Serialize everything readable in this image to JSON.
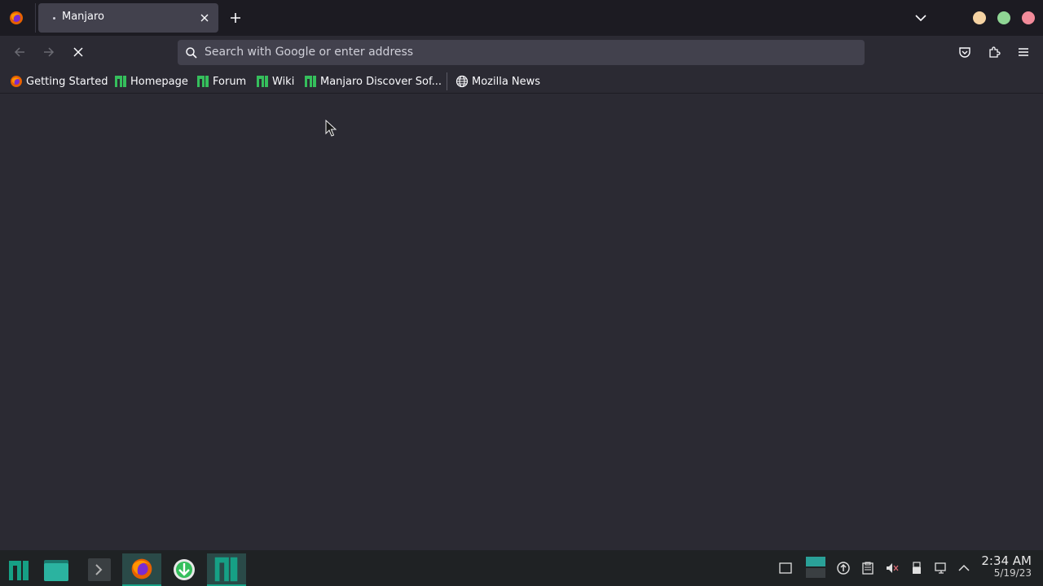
{
  "browser": {
    "tab": {
      "title": "Manjaro"
    },
    "urlbar": {
      "placeholder": "Search with Google or enter address"
    }
  },
  "bookmarks": [
    {
      "label": "Getting Started",
      "icon": "firefox-icon"
    },
    {
      "label": "Homepage",
      "icon": "manjaro-icon"
    },
    {
      "label": "Forum",
      "icon": "manjaro-icon"
    },
    {
      "label": "Wiki",
      "icon": "manjaro-icon"
    },
    {
      "label": "Manjaro Discover Sof...",
      "icon": "manjaro-icon"
    },
    {
      "label": "Mozilla News",
      "icon": "globe-icon"
    }
  ],
  "window_controls": {
    "colors": {
      "minimize": "#f5d3a3",
      "maximize": "#8fd694",
      "close": "#f28b9a"
    }
  },
  "taskbar": {
    "apps": [
      "manjaro-menu-icon",
      "files-icon",
      "terminal-icon",
      "firefox-icon",
      "downloader-icon",
      "manjaro-hello-icon"
    ],
    "clock": {
      "time": "2:34 AM",
      "date": "5/19/23"
    }
  },
  "colors": {
    "accent": "#16a085",
    "manjaro_green": "#35bf5c"
  }
}
